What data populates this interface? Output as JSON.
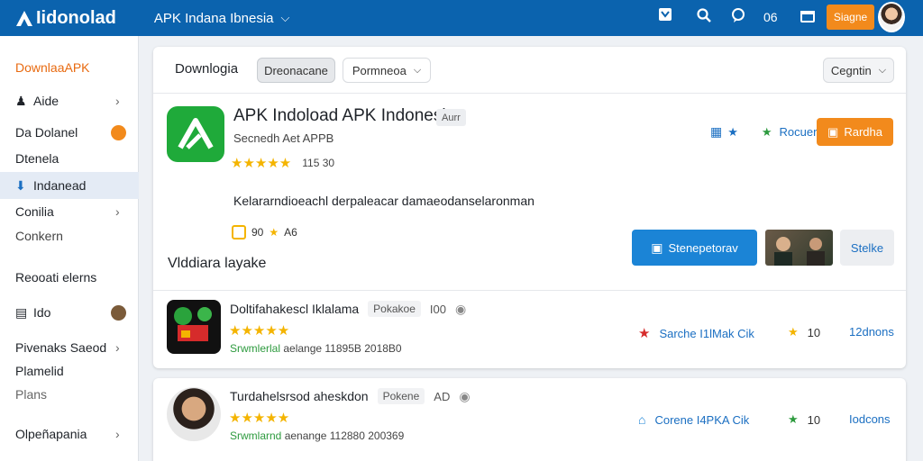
{
  "topbar": {
    "brand": "Iidonolad",
    "site_menu": "APK Indana Ibnesia",
    "count": "06",
    "signin_label": "Siagne"
  },
  "sidebar": {
    "heading": "DownlaaAPK",
    "items": [
      {
        "label": "Aide"
      },
      {
        "label": "Da Dolanel"
      },
      {
        "label": "Dtenela"
      },
      {
        "label": "Indanead"
      },
      {
        "label": "Conilia"
      },
      {
        "label": "Conkern"
      },
      {
        "label": "Reooati elerns"
      },
      {
        "label": "Ido"
      },
      {
        "label": "Pivenaks Saeod"
      },
      {
        "label": "Plamelid"
      },
      {
        "label": "Plans"
      },
      {
        "label": "Olpeñapania"
      }
    ]
  },
  "panel": {
    "title": "Downlogia",
    "chip_active": "Dreonacane",
    "chip_dropdown": "Pormneoa",
    "chip_right": "Cegntin"
  },
  "featured": {
    "title": "APK Indoload APK Indonesia",
    "badge": "Aurr",
    "subtitle": "Secnedh Aet APPB",
    "rating_count": "115 30",
    "status_label": "Rocuer",
    "get_label": "Rardha",
    "description": "Kelararndioeachl derpaleacar damaeodanselaronman",
    "mini_label": "90",
    "mini_extra": "A6",
    "section_label": "Vlddiara layake",
    "primary_label": "Stenepetorav",
    "share_label": "Stelke"
  },
  "rows": [
    {
      "title": "Doltifahakescl Iklalama",
      "badge": "Pokakoe",
      "extra": "I00",
      "meta_green": "Srwmlerlal",
      "meta": "aelange 11895B 2018B0",
      "action": "Sarche I1lMak Cik",
      "mid_count": "10",
      "right": "12dnons"
    },
    {
      "title": "Turdahelsrsod aheskdon",
      "badge": "Pokene",
      "extra": "AD",
      "meta_green": "Srwmlarnd",
      "meta": "aenange 112880 200369",
      "action": "Corene I4PKA Cik",
      "mid_count": "10",
      "right": "Iodcons"
    }
  ],
  "colors": {
    "topbar": "#0b63ae",
    "accent_orange": "#f28a1c",
    "primary_blue": "#1b84d6",
    "brand_green": "#1faa3a",
    "star": "#f4b400"
  }
}
